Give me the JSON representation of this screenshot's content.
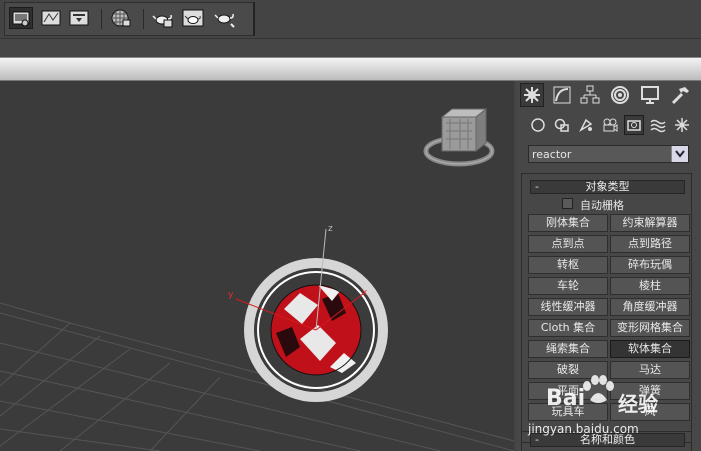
{
  "toolbar": {
    "buttons": [
      "render-setup",
      "curve-editor",
      "render-frame-window",
      "material-editor",
      "teapot-render",
      "teapot-render-frame",
      "teapot-quick-render"
    ]
  },
  "viewport": {
    "gizmo_labels": {
      "z": "z",
      "x": "x",
      "y": "y"
    }
  },
  "command_panel": {
    "tabs": [
      "create",
      "modify",
      "hierarchy",
      "motion",
      "display",
      "utilities"
    ],
    "subcategories": [
      "geometry",
      "shapes",
      "lights",
      "cameras",
      "helpers",
      "space-warps",
      "systems"
    ],
    "category_dropdown": {
      "value": "reactor"
    },
    "object_type": {
      "title": "对象类型",
      "collapse_symbol": "-",
      "autogrid_label": "自动栅格",
      "buttons": [
        "刚体集合",
        "约束解算器",
        "点到点",
        "点到路径",
        "转枢",
        "碎布玩偶",
        "车轮",
        "棱柱",
        "线性缓冲器",
        "角度缓冲器",
        "Cloth 集合",
        "变形网格集合",
        "绳索集合",
        "软体集合",
        "破裂",
        "马达",
        "平面",
        "弹簧",
        "玩具车",
        "风"
      ],
      "pressed_index": 13
    },
    "name_color": {
      "title": "名称和颜色",
      "collapse_symbol": "-"
    }
  },
  "watermark": {
    "brand": "Bai",
    "brand2": "经验",
    "url": "jingyan.baidu.com"
  },
  "colors": {
    "accent_red": "#c0101a",
    "viewport_bg": "#3b3b3b",
    "panel_bg": "#474747"
  }
}
